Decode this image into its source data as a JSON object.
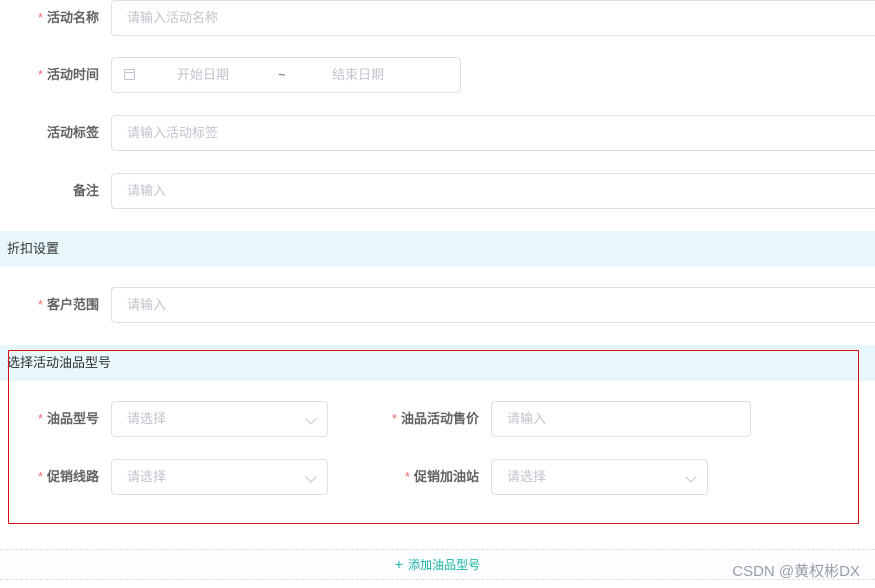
{
  "form": {
    "activity_name": {
      "label": "活动名称",
      "required": true,
      "placeholder": "请输入活动名称"
    },
    "activity_time": {
      "label": "活动时间",
      "required": true,
      "start_placeholder": "开始日期",
      "separator": "~",
      "end_placeholder": "结束日期"
    },
    "activity_tag": {
      "label": "活动标签",
      "required": false,
      "placeholder": "请输入活动标签"
    },
    "remark": {
      "label": "备注",
      "required": false,
      "placeholder": "请输入"
    }
  },
  "discount_section": {
    "title": "折扣设置"
  },
  "customer_scope": {
    "label": "客户范围",
    "required": true,
    "placeholder": "请输入"
  },
  "oil_section": {
    "title": "选择活动油品型号"
  },
  "oil_model": {
    "label": "油品型号",
    "required": true,
    "placeholder": "请选择"
  },
  "oil_price": {
    "label": "油品活动售价",
    "required": true,
    "placeholder": "请输入"
  },
  "promo_route": {
    "label": "促销线路",
    "required": true,
    "placeholder": "请选择"
  },
  "promo_station": {
    "label": "促销加油站",
    "required": true,
    "placeholder": "请选择"
  },
  "add_oil_model": {
    "icon": "plus-icon",
    "label": "添加油品型号"
  },
  "required_mark": "*",
  "watermark": "CSDN @黄权彬DX",
  "colors": {
    "required": "#f56c6c",
    "section_bg": "#e8f7fa",
    "accent": "#17b3a3",
    "highlight_border": "#d8101b"
  }
}
